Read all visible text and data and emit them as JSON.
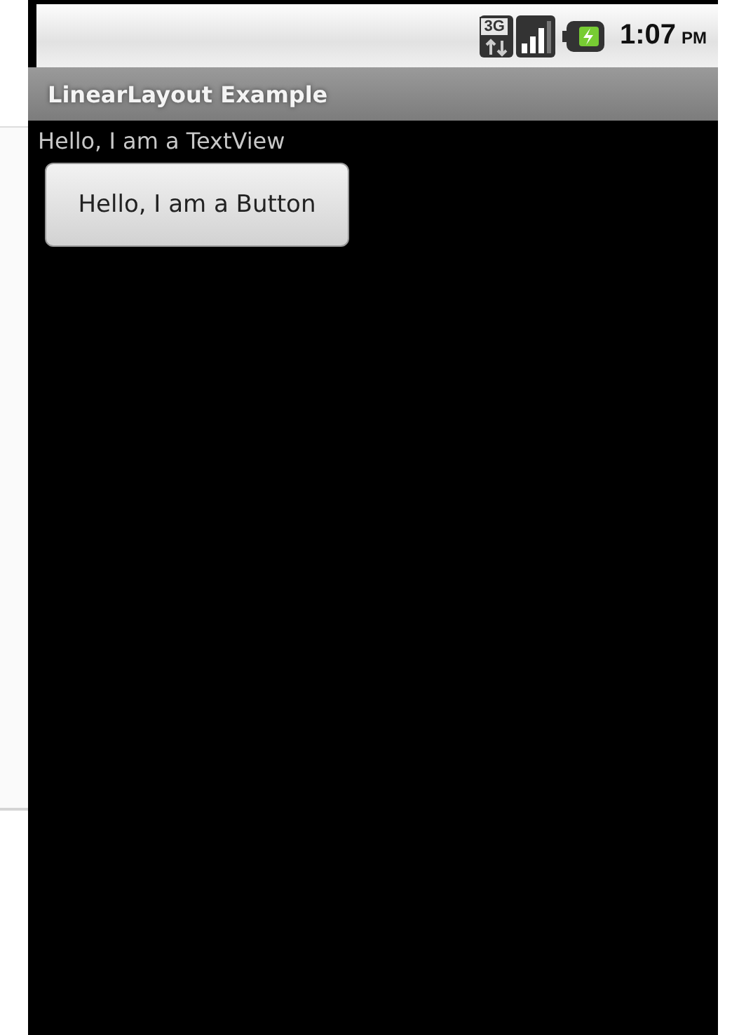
{
  "status_bar": {
    "time": "1:07",
    "meridiem": "PM",
    "network": "3G"
  },
  "title_bar": {
    "title": "LinearLayout Example"
  },
  "content": {
    "text_view": "Hello, I am a TextView",
    "button": "Hello, I am a Button"
  }
}
